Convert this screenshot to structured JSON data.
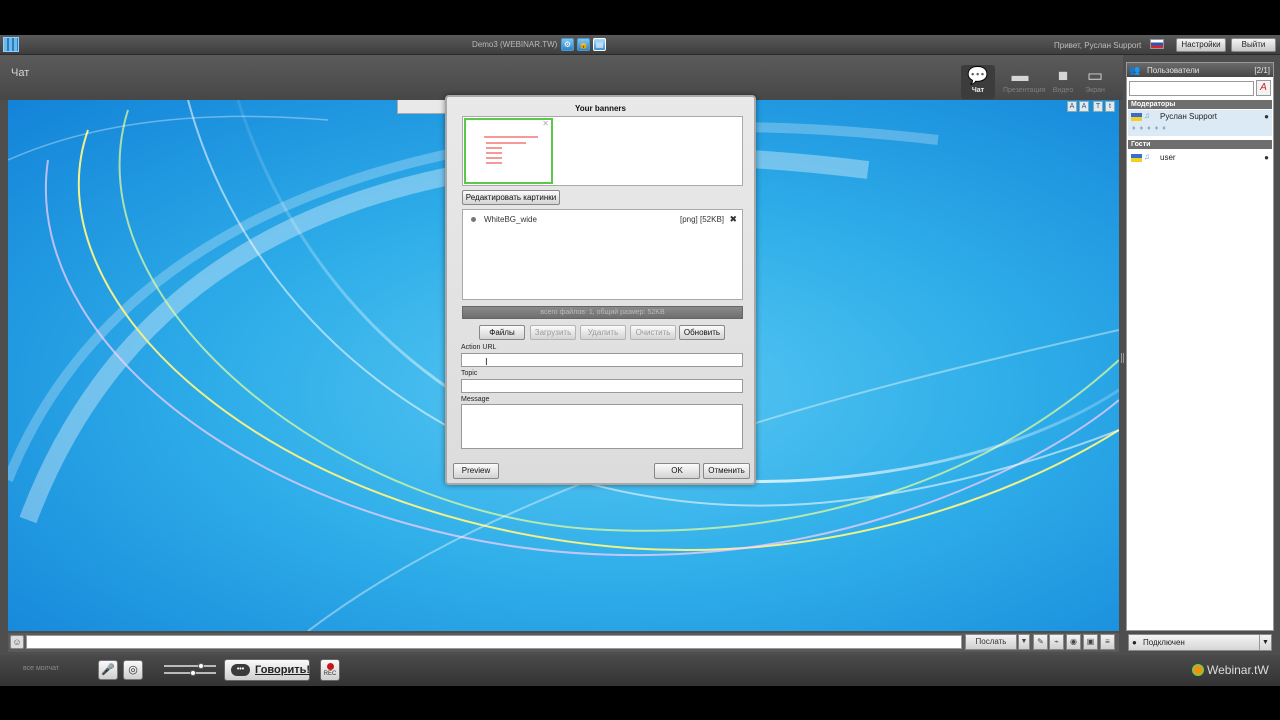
{
  "topbar": {
    "room_title": "Demo3 (WEBINAR.TW)",
    "greeting": "Привет, Руслан Support",
    "settings_label": "Настройки",
    "logout_label": "Выйти"
  },
  "toolbar": {
    "chat_title": "Чат",
    "modes": [
      {
        "label": "Чат",
        "icon": "chat-bubble-icon"
      },
      {
        "label": "Презентация",
        "icon": "presentation-icon"
      },
      {
        "label": "Видео",
        "icon": "video-camera-icon"
      },
      {
        "label": "Экран",
        "icon": "monitor-icon"
      }
    ]
  },
  "stage_tools": [
    "A",
    "A",
    "T",
    "t"
  ],
  "dialog": {
    "title": "Your banners",
    "edit_images_label": "Редактировать картинки",
    "file": {
      "name": "WhiteBG_wide",
      "info": "[png] [52KB]"
    },
    "summary": "всего файлов: 1, общий размер: 52KB",
    "buttons": {
      "files": "Файлы",
      "upload": "Загрузить",
      "delete": "Удалить",
      "clear": "Очистить",
      "refresh": "Обновить",
      "preview": "Preview",
      "ok": "OK",
      "cancel": "Отменить"
    },
    "fields": {
      "action_url": {
        "label": "Action URL",
        "value": ""
      },
      "topic": {
        "label": "Topic",
        "value": ""
      },
      "message": {
        "label": "Message",
        "value": ""
      }
    }
  },
  "chatbar": {
    "input_value": "",
    "send_label": "Послать"
  },
  "bottombar": {
    "hear_all": "все молчат",
    "speak_label": "Говорить!",
    "rec_label": "REC",
    "brand": "Webinar.tW"
  },
  "users_panel": {
    "title": "Пользователи",
    "count": "[2/1]",
    "groups": [
      {
        "title": "Модераторы",
        "users": [
          {
            "name": "Руслан Support"
          }
        ]
      },
      {
        "title": "Гости",
        "users": [
          {
            "name": "user"
          }
        ]
      }
    ],
    "status": "Подключен"
  },
  "colors": {
    "stage_light": "#5ac8f2",
    "stage_dark": "#1383d8",
    "chrome": "#4e4e4e",
    "thumbnail_border": "#5ac848",
    "rec_dot": "#c8171b"
  }
}
